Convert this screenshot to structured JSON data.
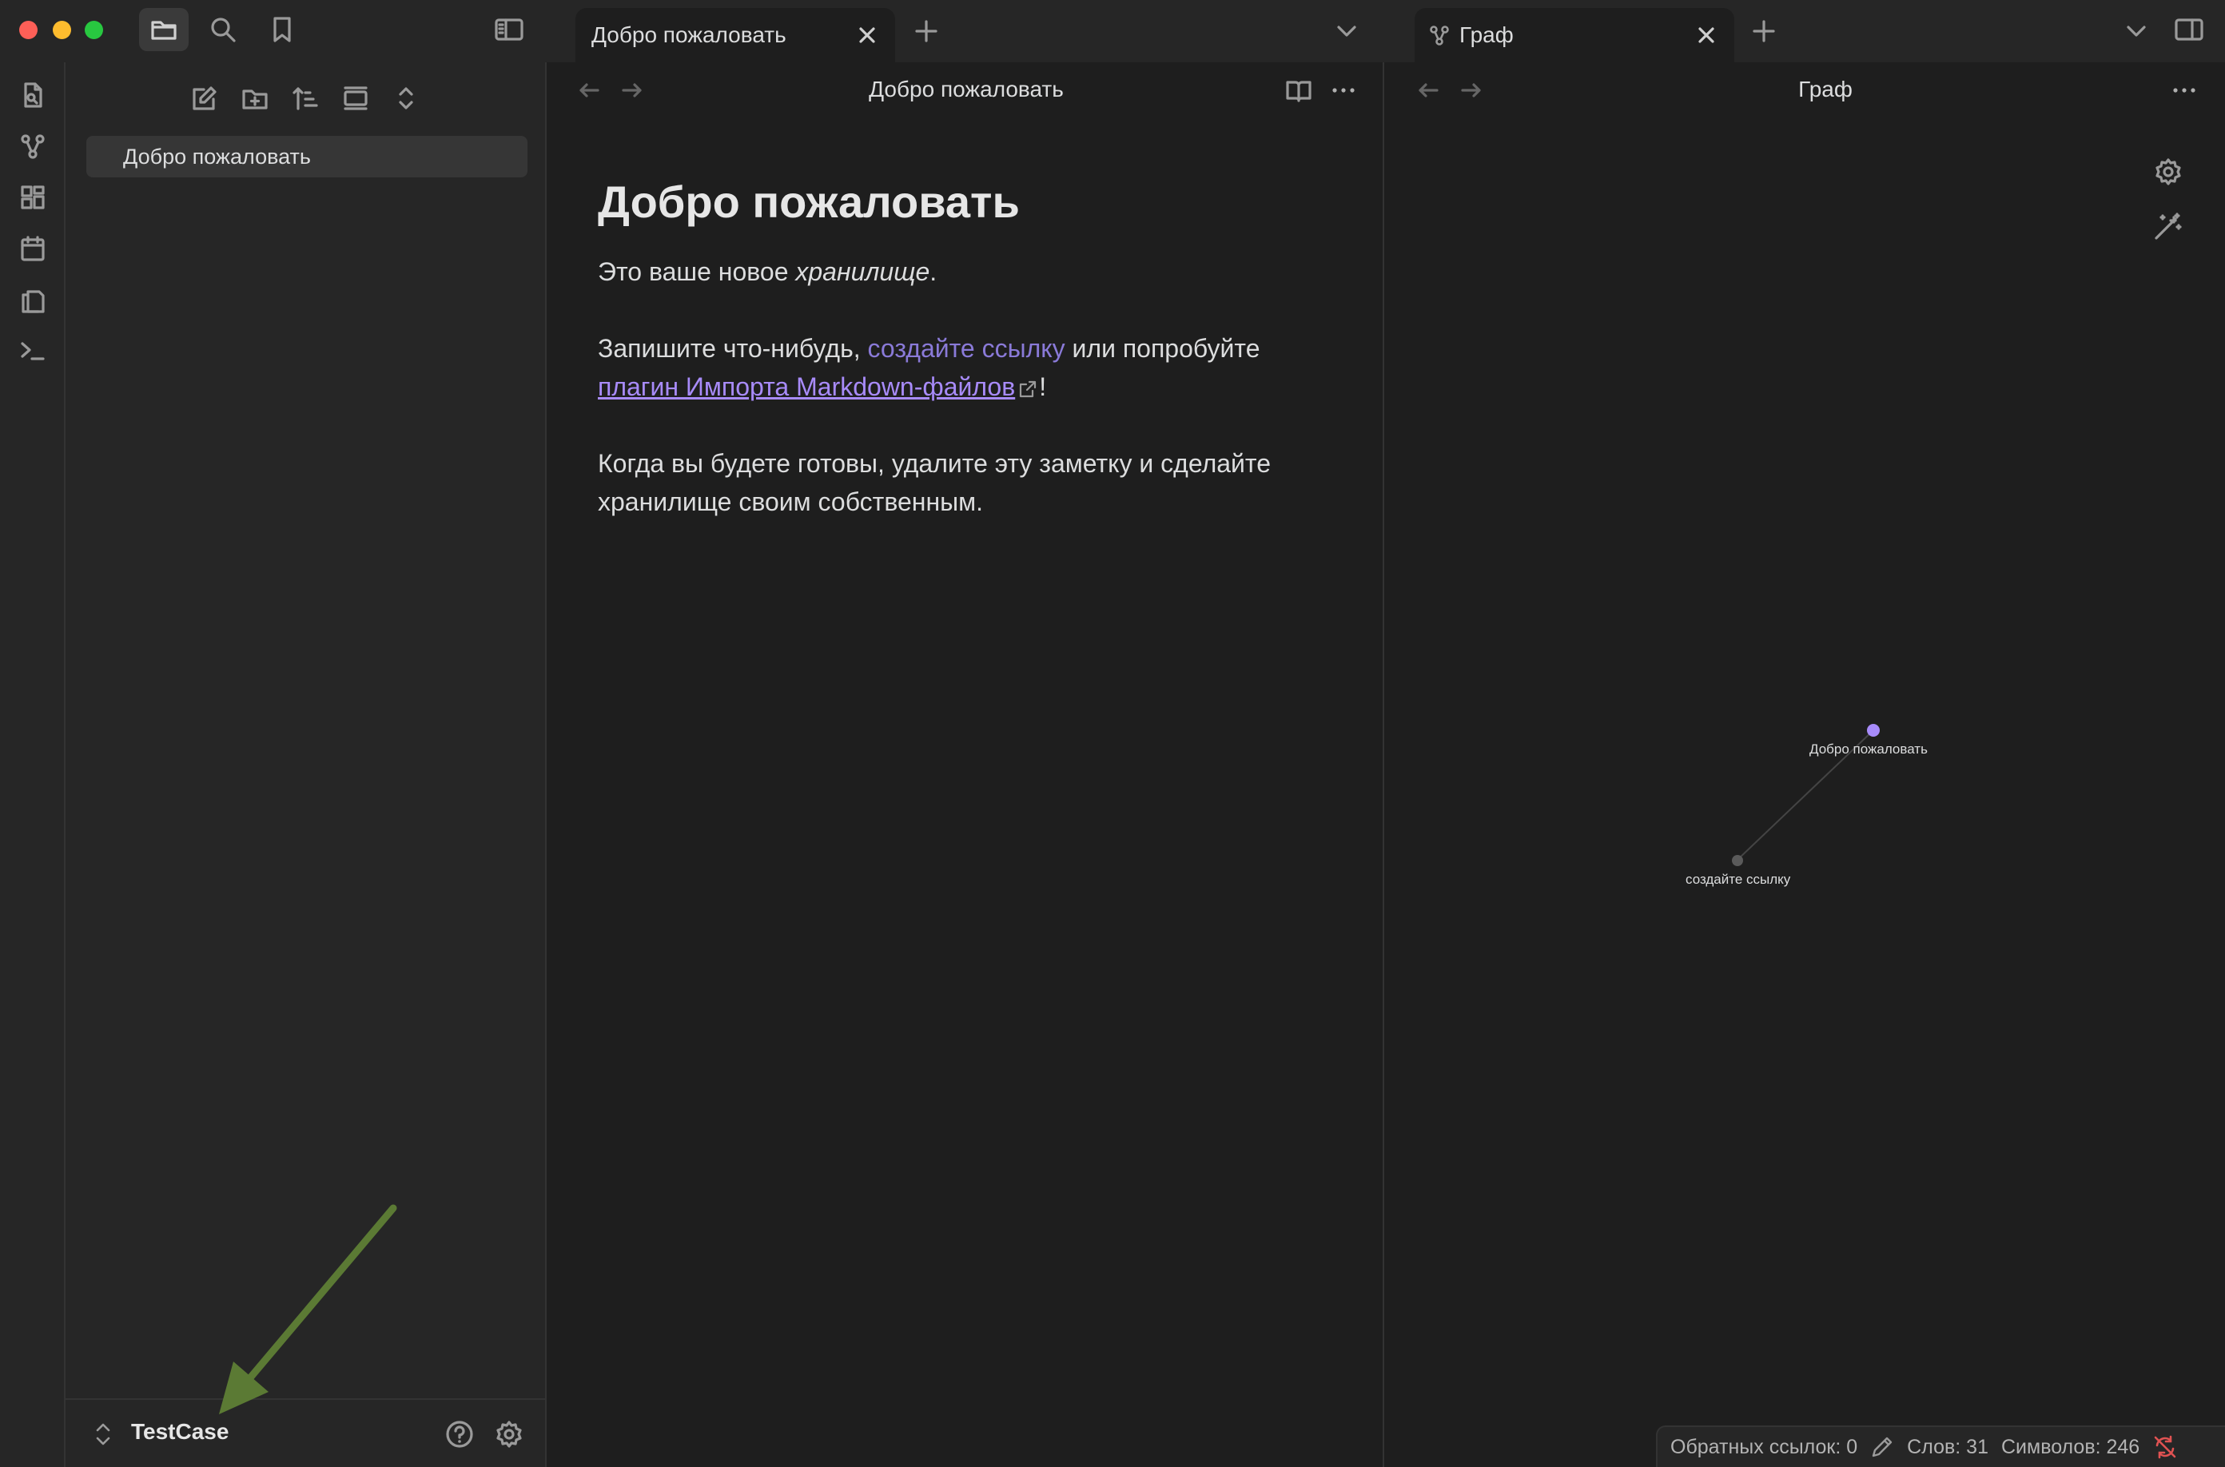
{
  "titlebar": {
    "tabs": [
      {
        "label": "Добро пожаловать"
      },
      {
        "label": "Граф"
      }
    ]
  },
  "sidebar": {
    "files": [
      {
        "label": "Добро пожаловать"
      }
    ],
    "vault_name": "TestCase"
  },
  "editor": {
    "view_title": "Добро пожаловать",
    "heading": "Добро пожаловать",
    "p1_start": "Это ваше новое ",
    "p1_em": "хранилище",
    "p1_end": ".",
    "p2_start": "Запишите что-нибудь, ",
    "p2_internal_link": "создайте ссылку",
    "p2_middle": " или попробуйте ",
    "p2_external_link": "плагин Импорта Markdown-файлов",
    "p2_end": "!",
    "p3": "Когда вы будете готовы, удалите эту заметку и сделайте хранилище своим собственным."
  },
  "graph": {
    "view_title": "Граф",
    "nodes": [
      {
        "label": "Добро пожаловать",
        "color": "#a78bfa"
      },
      {
        "label": "создайте ссылку",
        "color": "#5a5a5a"
      }
    ]
  },
  "statusbar": {
    "backlinks": "Обратных ссылок: 0",
    "words": "Слов: 31",
    "chars": "Символов: 246"
  },
  "colors": {
    "accent": "#a88bfa",
    "annotation_arrow": "#5b7a34",
    "sync_error": "#e05252"
  },
  "icons": [
    "folder-icon",
    "search-icon",
    "bookmark-icon",
    "sidebar-toggle-icon",
    "plus-icon",
    "chevron-down-icon",
    "close-icon",
    "graph-icon",
    "open-file-icon",
    "canvas-icon",
    "calendar-icon",
    "templates-icon",
    "terminal-icon",
    "new-note-icon",
    "new-folder-icon",
    "sort-icon",
    "collapse-icon",
    "expand-icon",
    "back-arrow-icon",
    "forward-arrow-icon",
    "reading-view-icon",
    "more-options-icon",
    "settings-icon",
    "magic-wand-icon",
    "help-icon",
    "pencil-icon",
    "sync-off-icon",
    "right-sidebar-icon"
  ]
}
